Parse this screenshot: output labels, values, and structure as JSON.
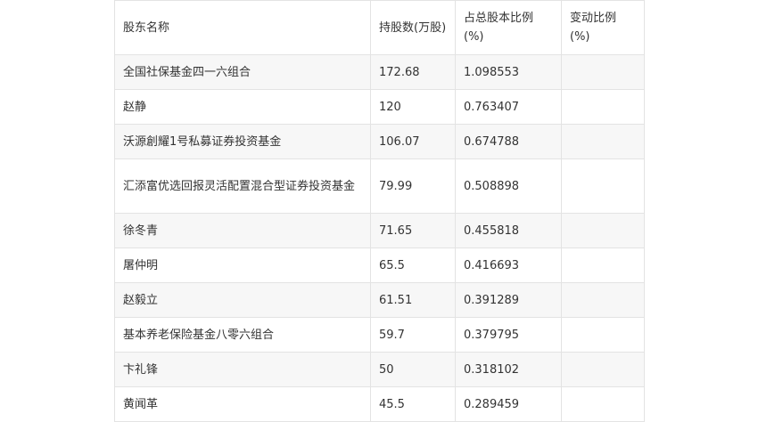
{
  "table": {
    "headers": {
      "name": "股东名称",
      "shares": "持股数(万股)",
      "ratio": "占总股本比例(%)",
      "change": "变动比例(%)"
    },
    "rows": [
      {
        "name": "全国社保基金四一六组合",
        "shares": "172.68",
        "ratio": "1.098553",
        "change": ""
      },
      {
        "name": "赵静",
        "shares": "120",
        "ratio": "0.763407",
        "change": ""
      },
      {
        "name": "沃源創耀1号私募证券投资基金",
        "shares": "106.07",
        "ratio": "0.674788",
        "change": ""
      },
      {
        "name": "汇添富优选回报灵活配置混合型证券投资基金",
        "shares": "79.99",
        "ratio": "0.508898",
        "change": ""
      },
      {
        "name": "徐冬青",
        "shares": "71.65",
        "ratio": "0.455818",
        "change": ""
      },
      {
        "name": "屠仲明",
        "shares": "65.5",
        "ratio": "0.416693",
        "change": ""
      },
      {
        "name": "赵毅立",
        "shares": "61.51",
        "ratio": "0.391289",
        "change": ""
      },
      {
        "name": "基本养老保险基金八零六组合",
        "shares": "59.7",
        "ratio": "0.379795",
        "change": ""
      },
      {
        "name": "卞礼锋",
        "shares": "50",
        "ratio": "0.318102",
        "change": ""
      },
      {
        "name": "黄闻革",
        "shares": "45.5",
        "ratio": "0.289459",
        "change": ""
      }
    ]
  }
}
